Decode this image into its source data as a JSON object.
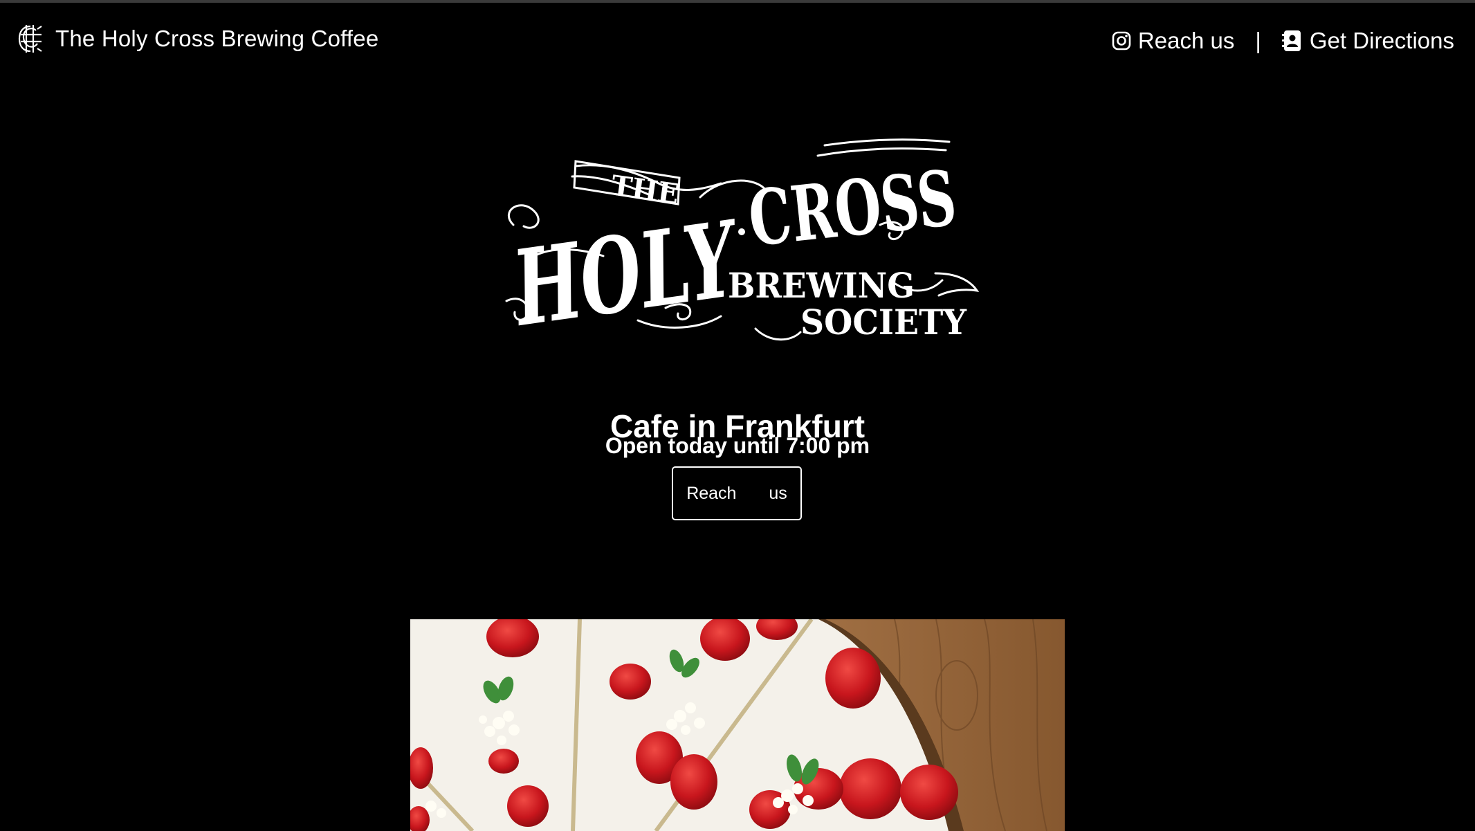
{
  "navbar": {
    "brand_name": "The Holy Cross Brewing Coffee",
    "brand_icon": "monogram-logo-icon",
    "links": [
      {
        "label": "Reach us",
        "icon": "instagram-icon"
      },
      {
        "label": "Get Directions",
        "icon": "contact-card-icon"
      }
    ],
    "separator": "|"
  },
  "hero": {
    "logo_alt": "The Holy Cross Brewing Society logo",
    "logo_text": {
      "the": "THE",
      "holy": "HOLY",
      "cross": "CROSS",
      "brewing": "BREWING",
      "society": "SOCIETY"
    },
    "headline": "Cafe in Frankfurt",
    "hours": "Open today until 7:00 pm",
    "cta_label": "Reach us"
  },
  "gallery": {
    "image_subject": "strawberry cream tart slices on wooden board"
  },
  "colors": {
    "background": "#000000",
    "text": "#ffffff",
    "accent_strawberry": "#c8161d",
    "cream": "#f4f1ea",
    "wood": "#9a6a3f"
  }
}
